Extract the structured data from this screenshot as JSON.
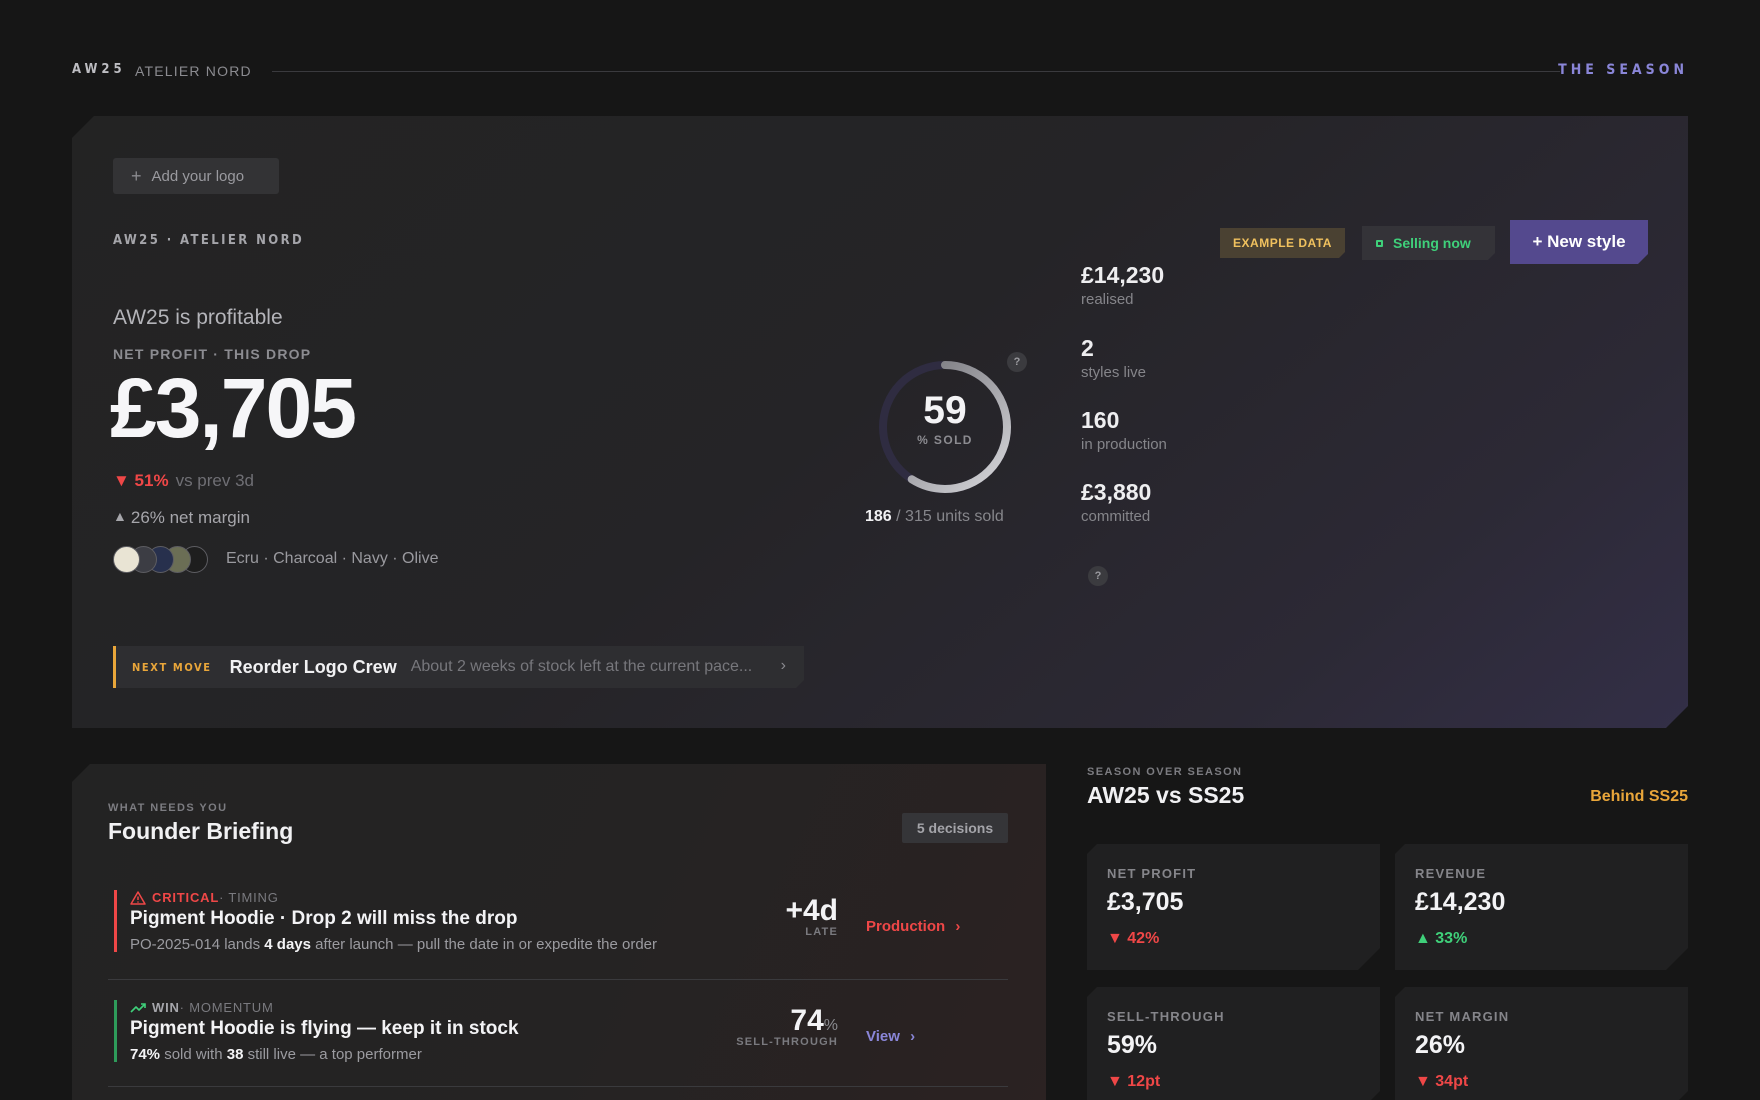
{
  "header": {
    "season": "AW25",
    "brand": "ATELIER NORD",
    "section": "THE SEASON"
  },
  "hero": {
    "add_logo": "Add your logo",
    "eyebrow": "AW25 · ATELIER NORD",
    "example_badge": "EXAMPLE DATA",
    "status_pill": "Selling now",
    "new_style_button": "+ New style",
    "headline": "AW25 is profitable",
    "profit_eyebrow": "NET PROFIT · THIS DROP",
    "profit_amount": "£3,705",
    "delta_value": "▼ 51%",
    "delta_caption": "vs prev 3d",
    "margin_arrow": "▲",
    "margin_text": "26% net margin",
    "colorways": "Ecru · Charcoal · Navy · Olive",
    "swatch_colors": [
      "#e9e4d4",
      "#3c3d44",
      "#27304d",
      "#6b6e55",
      "#1e1e1e"
    ],
    "sold_percent": 59,
    "sold_percent_label": "% SOLD",
    "sold_units": "186",
    "total_units_text": "/ 315 units sold",
    "help_glyph": "?",
    "stats": [
      {
        "value": "£14,230",
        "label": "realised"
      },
      {
        "value": "2",
        "label": "styles live"
      },
      {
        "value": "160",
        "label": "in production"
      },
      {
        "value": "£3,880",
        "label": "committed"
      }
    ],
    "next_move": {
      "eyebrow": "NEXT MOVE",
      "title": "Reorder Logo Crew",
      "body": "About 2 weeks of stock left at the current pace...",
      "chevron": "›"
    }
  },
  "briefing": {
    "eyebrow": "WHAT NEEDS YOU",
    "title": "Founder Briefing",
    "badge": "5 decisions",
    "items": [
      {
        "tag": "CRITICAL",
        "category": "· TIMING",
        "title": "Pigment Hoodie · Drop 2 will miss the drop",
        "body_pre": "PO-2025-014 lands ",
        "body_bold": "4 days",
        "body_post": " after launch — pull the date in or expedite the order",
        "metric": "+4d",
        "metric_caption": "LATE",
        "action": "Production",
        "action_chevron": "›"
      },
      {
        "tag": "WIN",
        "category": "· MOMENTUM",
        "title": "Pigment Hoodie is flying — keep it in stock",
        "body_b1": "74%",
        "body_t1": " sold with ",
        "body_b2": "38",
        "body_t2": " still live — a top performer",
        "metric": "74",
        "metric_unit": "%",
        "metric_caption": "SELL-THROUGH",
        "action": "View",
        "action_chevron": "›"
      }
    ]
  },
  "season_over_season": {
    "eyebrow": "SEASON OVER SEASON",
    "title": "AW25 vs SS25",
    "status": "Behind SS25",
    "kpis": [
      {
        "label": "NET PROFIT",
        "value": "£3,705",
        "delta": "▼ 42%",
        "direction": "down"
      },
      {
        "label": "REVENUE",
        "value": "£14,230",
        "delta": "▲ 33%",
        "direction": "up"
      },
      {
        "label": "SELL-THROUGH",
        "value": "59%",
        "delta": "▼ 12pt",
        "direction": "down"
      },
      {
        "label": "NET MARGIN",
        "value": "26%",
        "delta": "▼ 34pt",
        "direction": "down"
      }
    ]
  },
  "colors": {
    "accent": "#54498e",
    "critical": "#ef4747",
    "win": "#3fd07a",
    "warning": "#e9a63a",
    "link": "#8a86d8"
  }
}
